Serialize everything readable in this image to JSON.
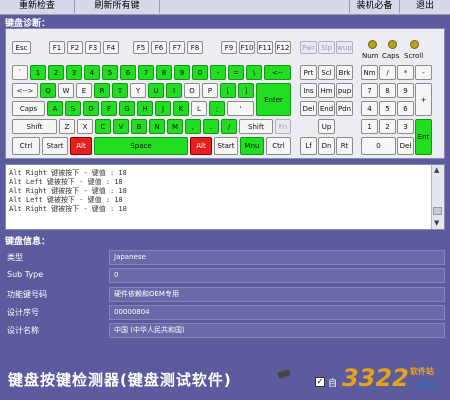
{
  "toolbar": {
    "recheck": "重新检查",
    "refresh": "刷新所有键",
    "essentials": "装机必备",
    "exit": "退出"
  },
  "keyboard": {
    "section_title": "键盘诊断：",
    "leds": [
      "Num",
      "Caps",
      "Scroll"
    ],
    "key_labels": {
      "esc": "Esc",
      "f1": "F1",
      "f2": "F2",
      "f3": "F3",
      "f4": "F4",
      "f5": "F5",
      "f6": "F6",
      "f7": "F7",
      "f8": "F8",
      "f9": "F9",
      "f10": "F10",
      "f11": "F11",
      "f12": "F12",
      "pwr": "Pwr",
      "slp": "Slp",
      "wup": "wup",
      "backtick": "`",
      "1": "1",
      "2": "2",
      "3": "3",
      "4": "4",
      "5": "5",
      "6": "6",
      "7": "7",
      "8": "8",
      "9": "9",
      "0": "0",
      "minus": "-",
      "equal": "=",
      "yen": "\\",
      "back": "<--",
      "tab": "<-->",
      "q": "Q",
      "w": "W",
      "e": "E",
      "r": "R",
      "t": "T",
      "y": "Y",
      "u": "U",
      "i": "I",
      "o": "O",
      "p": "P",
      "lbracket": "[",
      "rbracket": "]",
      "enter": "Enter",
      "caps": "Caps",
      "a": "A",
      "s": "S",
      "d": "D",
      "f": "F",
      "g": "G",
      "h": "H",
      "j": "J",
      "k": "K",
      "l": "L",
      "semicolon": ";",
      "quote": "'",
      "lshift": "Shift",
      "z": "Z",
      "x": "X",
      "c": "C",
      "v": "V",
      "b": "B",
      "n": "N",
      "m": "M",
      "comma": ",",
      "period": ".",
      "slash": "/",
      "rshift": "Shift",
      "fn": "Fn",
      "lctrl": "Ctrl",
      "lstart": "Start",
      "lalt": "Alt",
      "space": "Space",
      "ralt": "Alt",
      "rstart": "Start",
      "menu": "Mnu",
      "rctrl": "Ctrl",
      "prt": "Prt",
      "scl": "Scl",
      "brk": "Brk",
      "ins": "Ins",
      "hm": "Hm",
      "pup": "pup",
      "del": "Del",
      "end": "End",
      "pdn": "Pdn",
      "up": "Up",
      "left": "Lf",
      "down": "Dn",
      "right": "Rt",
      "nm": "Nm",
      "kp_slash": "/",
      "kp_star": "*",
      "kp_minus": "-",
      "kp_7": "7",
      "kp_8": "8",
      "kp_9": "9",
      "kp_plus": "+",
      "kp_4": "4",
      "kp_5": "5",
      "kp_6": "6",
      "kp_1": "1",
      "kp_2": "2",
      "kp_3": "3",
      "kp_enter": "Ent",
      "kp_0": "0",
      "kp_del": "Del"
    }
  },
  "log": {
    "lines": [
      "Alt Right  键被按下 - 键值 : 18",
      "Alt Left  键被按下 - 键值 : 18",
      "Alt Right  键被按下 - 键值 : 18",
      "Alt Left  键被按下 - 键值 : 18",
      "Alt Right  键被按下 - 键值 : 18"
    ],
    "scroll_up": "▲",
    "scroll_down": "▼"
  },
  "info": {
    "section_title": "键盘信息：",
    "rows": [
      {
        "label": "类型",
        "value": "Japanese"
      },
      {
        "label": "Sub Type",
        "value": "0"
      },
      {
        "label": "功能键号码",
        "value": "硬件依赖和OEM专用"
      },
      {
        "label": "设计序号",
        "value": "00000804"
      },
      {
        "label": "设计名称",
        "value": "中国 (中华人民共和国)"
      }
    ]
  },
  "footer": {
    "title": "键盘按键检测器(键盘测试软件)",
    "checkbox_mark": "✓",
    "checkbox_label": "自",
    "logo_number": "3322",
    "logo_cn": "软件站",
    "logo_domain": ".cc"
  },
  "colors": {
    "pressed": "#22dd22",
    "active": "#e41f1f",
    "background": "#5b5b9d"
  }
}
